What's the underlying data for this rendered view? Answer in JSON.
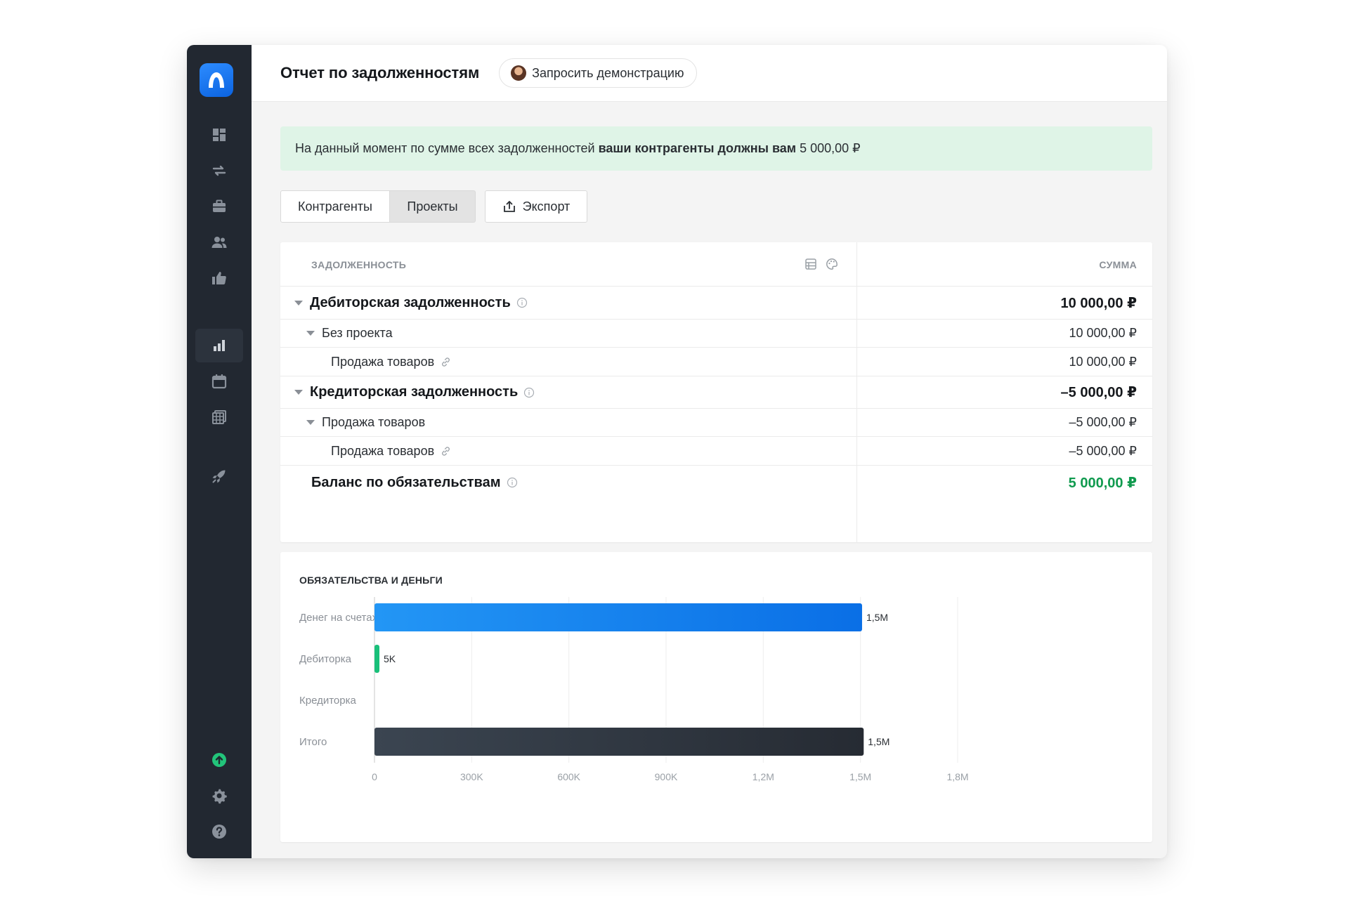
{
  "sidebar": {
    "icons": [
      "dashboard-icon",
      "transfer-arrows-icon",
      "briefcase-icon",
      "people-icon",
      "thumbs-up-icon",
      "bar-chart-icon",
      "calendar-icon",
      "table-icon",
      "rocket-icon",
      "upload-circle-icon",
      "gear-icon",
      "help-icon"
    ],
    "active": "bar-chart-icon"
  },
  "header": {
    "title": "Отчет по задолженностям",
    "demo_button": "Запросить демонстрацию"
  },
  "banner": {
    "prefix": "На данный момент по сумме всех задолженностей",
    "bold": "ваши контрагенты должны вам",
    "amount": "5 000,00 ₽"
  },
  "tabs": {
    "items": [
      "Контрагенты",
      "Проекты"
    ],
    "active": "Проекты",
    "export_label": "Экспорт"
  },
  "table": {
    "col_left": "ЗАДОЛЖЕННОСТЬ",
    "col_right": "СУММА",
    "rows": [
      {
        "label": "Дебиторская задолженность",
        "value": "10 000,00 ₽"
      },
      {
        "label": "Без проекта",
        "value": "10 000,00 ₽"
      },
      {
        "label": "Продажа товаров",
        "value": "10 000,00 ₽"
      },
      {
        "label": "Кредиторская задолженность",
        "value": "–5 000,00 ₽"
      },
      {
        "label": "Продажа товаров",
        "value": "–5 000,00 ₽"
      },
      {
        "label": "Продажа товаров",
        "value": "–5 000,00 ₽"
      },
      {
        "label": "Баланс по обязательствам",
        "value": "5 000,00 ₽"
      }
    ]
  },
  "chart_data": {
    "type": "bar",
    "orientation": "horizontal",
    "title": "ОБЯЗАТЕЛЬСТВА И ДЕНЬГИ",
    "categories": [
      "Денег на счетах",
      "Дебиторка",
      "Кредиторка",
      "Итого"
    ],
    "values": [
      1505000,
      10000,
      0,
      1510000
    ],
    "data_labels": [
      "1,5M",
      "5K",
      "",
      "1,5M"
    ],
    "colors": [
      "#1a7ff0",
      "#19c07a",
      "#cccccc",
      "#2c3139"
    ],
    "xlim": [
      0,
      1800000
    ],
    "xticks": [
      0,
      300000,
      600000,
      900000,
      1200000,
      1500000,
      1800000
    ],
    "xtick_labels": [
      "0",
      "300K",
      "600K",
      "900K",
      "1,2M",
      "1,5M",
      "1,8M"
    ],
    "grid": true
  }
}
